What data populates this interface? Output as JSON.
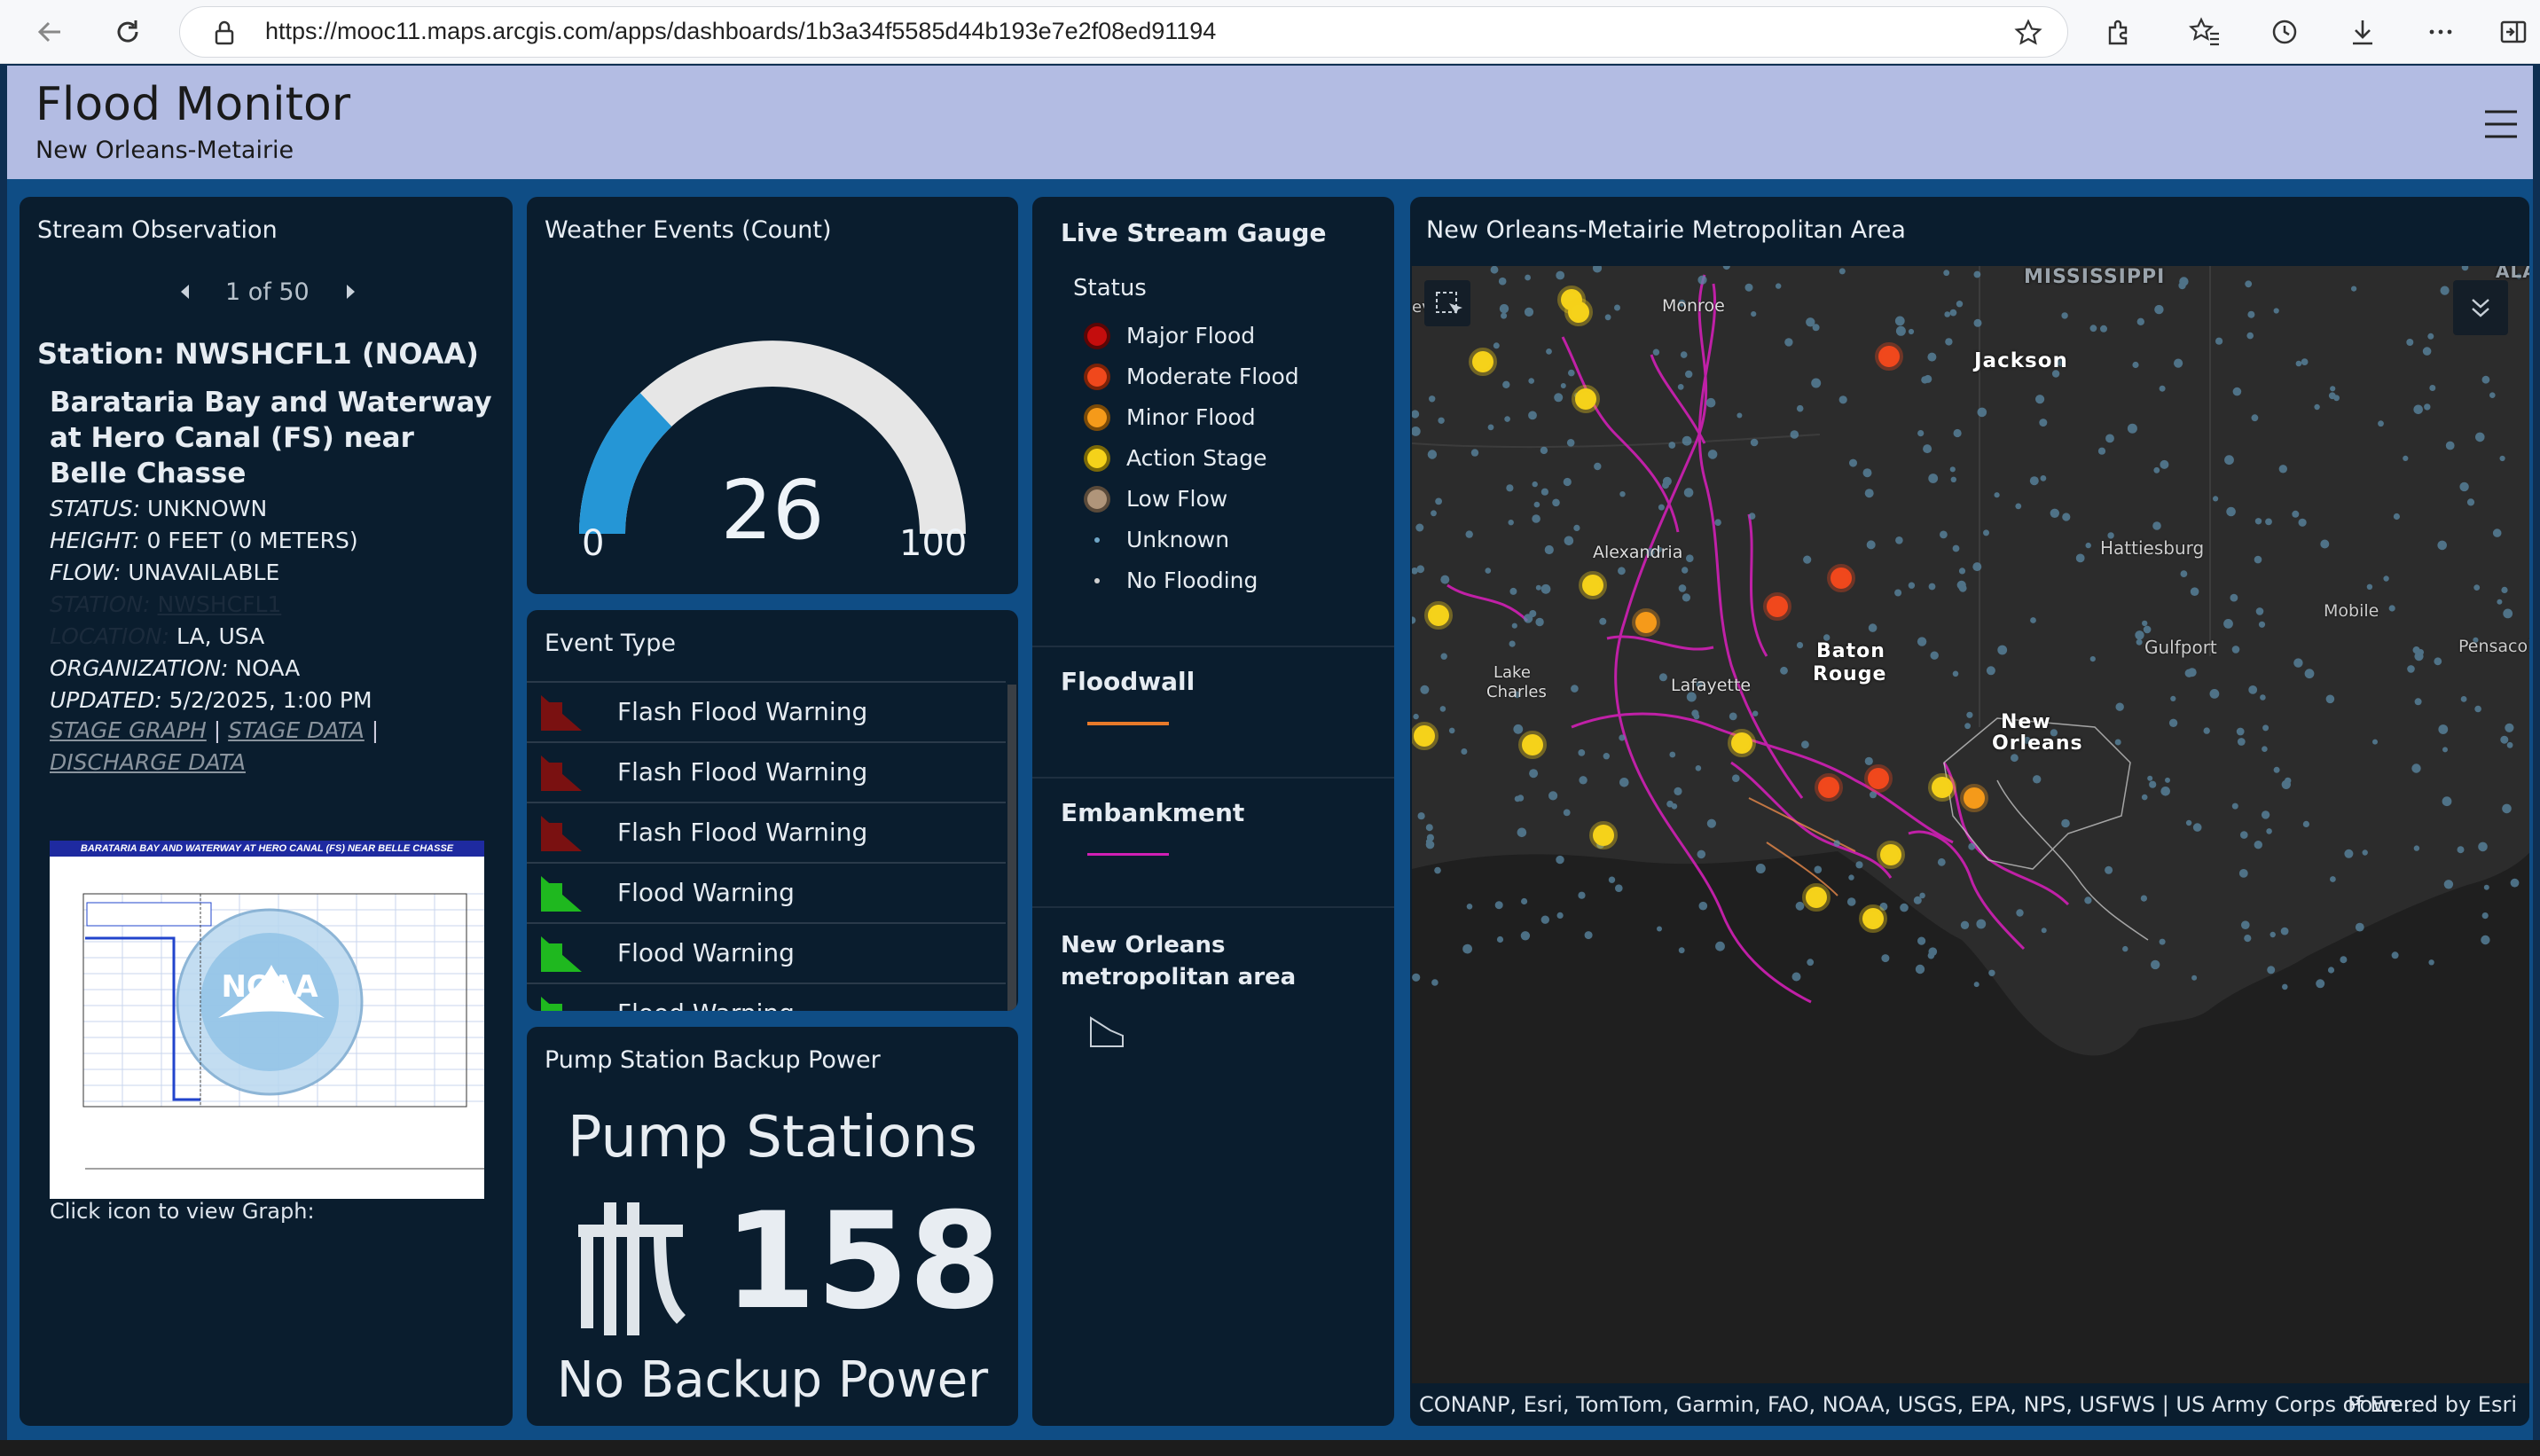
{
  "browser": {
    "url": "https://mooc11.maps.arcgis.com/apps/dashboards/1b3a34f5585d44b193e7e2f08ed91194",
    "icons": [
      "back-icon",
      "refresh-icon",
      "lock-icon",
      "favorite-star-icon",
      "extensions-icon",
      "favorites-icon",
      "history-icon",
      "downloads-icon",
      "more-icon",
      "sidebar-icon"
    ]
  },
  "header": {
    "title": "Flood Monitor",
    "subtitle": "New Orleans-Metairie"
  },
  "stream": {
    "title": "Stream Observation",
    "pager": "1 of 50",
    "station": "Station: NWSHCFL1 (NOAA)",
    "name": "Barataria Bay and Waterway at Hero Canal (FS) near Belle Chasse",
    "fields": [
      {
        "label": "STATUS:",
        "value": "UNKNOWN"
      },
      {
        "label": "HEIGHT:",
        "value": "0 FEET (0 METERS)"
      },
      {
        "label": "FLOW:",
        "value": "UNAVAILABLE"
      },
      {
        "label": "STATION:",
        "value": "NWSHCFL1"
      },
      {
        "label": "LOCATION:",
        "value": "LA, USA"
      },
      {
        "label": "ORGANIZATION:",
        "value": "NOAA"
      },
      {
        "label": "UPDATED:",
        "value": "5/2/2025, 1:00 PM"
      }
    ],
    "links": [
      "STAGE GRAPH",
      "STAGE DATA",
      "DISCHARGE DATA"
    ],
    "graph_title": "BARATARIA BAY AND WATERWAY AT HERO CANAL (FS) NEAR BELLE CHASSE",
    "graph_label": "NOAA",
    "click_text": "Click icon to view Graph:"
  },
  "weather": {
    "title": "Weather Events (Count)",
    "value": "26",
    "min": "0",
    "max": "100",
    "value_num": 26,
    "max_num": 100
  },
  "events": {
    "title": "Event Type",
    "items": [
      {
        "label": "Flash Flood Warning",
        "color": "#7a1111"
      },
      {
        "label": "Flash Flood Warning",
        "color": "#7a1111"
      },
      {
        "label": "Flash Flood Warning",
        "color": "#7a1111"
      },
      {
        "label": "Flood Warning",
        "color": "#1fb81f"
      },
      {
        "label": "Flood Warning",
        "color": "#1fb81f"
      },
      {
        "label": "Flood Warning",
        "color": "#1fb81f"
      }
    ]
  },
  "pump": {
    "title": "Pump Station Backup Power",
    "line1": "Pump Stations",
    "count": "158",
    "line2": "No Backup Power"
  },
  "legend": {
    "title": "Live Stream Gauge",
    "status_label": "Status",
    "status": [
      {
        "label": "Major Flood",
        "color": "#c40d0d",
        "ring": "#5a0606"
      },
      {
        "label": "Moderate Flood",
        "color": "#f0481c",
        "ring": "#7a2208"
      },
      {
        "label": "Minor Flood",
        "color": "#f59a1a",
        "ring": "#7a4a08"
      },
      {
        "label": "Action Stage",
        "color": "#f5d21a",
        "ring": "#7a6808"
      },
      {
        "label": "Low Flow",
        "color": "#b0957a",
        "ring": "#5a4a3a"
      },
      {
        "label": "Unknown",
        "color": "#6fa6c7",
        "ring": "#6fa6c7"
      },
      {
        "label": "No Flooding",
        "color": "#d0d0d0",
        "ring": "#d0d0d0"
      }
    ],
    "floodwall": "Floodwall",
    "floodwall_color": "#e87a2a",
    "embankment": "Embankment",
    "embankment_color": "#d11fb5",
    "metro": "New Orleans metropolitan area"
  },
  "map": {
    "title": "New Orleans-Metairie Metropolitan Area",
    "attribution": "CONANP, Esri, TomTom, Garmin, FAO, NOAA, USGS, EPA, NPS, USFWS | US Army Corps of En...",
    "powered": "Powered by Esri",
    "labels": [
      {
        "text": "MISSISSIPPI"
      },
      {
        "text": "ALA"
      },
      {
        "text": "Monroe"
      },
      {
        "text": "Jackson"
      },
      {
        "text": "Alexandria"
      },
      {
        "text": "Hattiesburg"
      },
      {
        "text": "Mobile"
      },
      {
        "text": "Pensacola"
      },
      {
        "text": "Baton"
      },
      {
        "text": "Rouge"
      },
      {
        "text": "Gulfport"
      },
      {
        "text": "Lake"
      },
      {
        "text": "Charles"
      },
      {
        "text": "Lafayette"
      },
      {
        "text": "New"
      },
      {
        "text": "Orleans"
      },
      {
        "text": "eve"
      }
    ]
  }
}
